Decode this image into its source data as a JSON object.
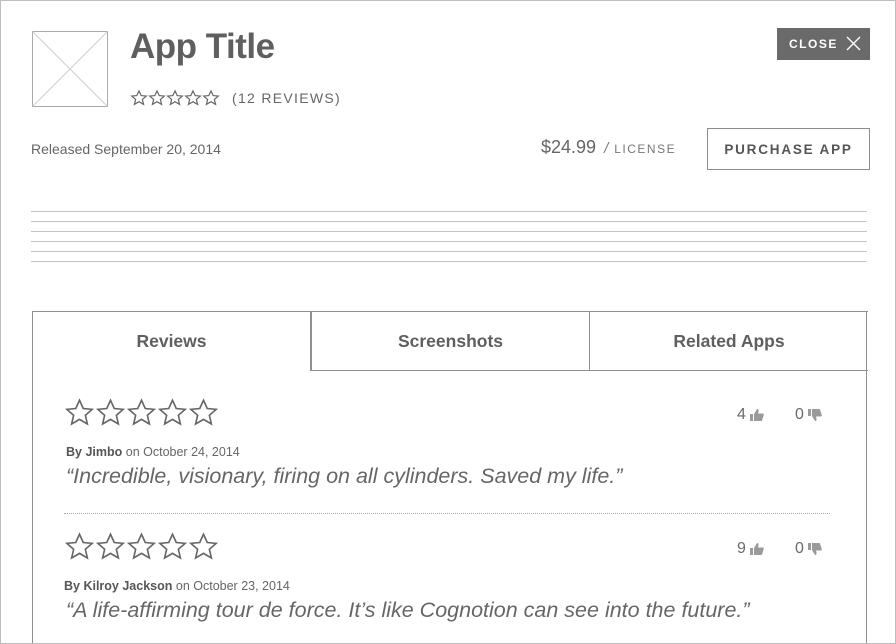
{
  "app": {
    "title": "App Title",
    "reviews_count": "(12 REVIEWS)",
    "released": "Released September 20, 2014",
    "price": "$24.99",
    "price_separator": "/",
    "price_unit": "LICENSE",
    "rating_stars": 0
  },
  "actions": {
    "close_label": "CLOSE",
    "purchase_label": "PURCHASE APP"
  },
  "tabs": [
    {
      "label": "Reviews",
      "active": true
    },
    {
      "label": "Screenshots",
      "active": false
    },
    {
      "label": "Related Apps",
      "active": false
    }
  ],
  "reviews": [
    {
      "author": "By Jimbo",
      "date": "on October 24, 2014",
      "quote": "“Incredible, visionary, firing on all cylinders. Saved my life.”",
      "stars": 0,
      "upvotes": "4",
      "downvotes": "0"
    },
    {
      "author": "By Kilroy Jackson",
      "date": "on October 23, 2014",
      "quote": "“A life-affirming tour de force. It’s like Cognotion can see into the future.”",
      "stars": 0,
      "upvotes": "9",
      "downvotes": "0"
    }
  ],
  "icons": {
    "close": "close-icon",
    "thumb_up": "thumbs-up-icon",
    "thumb_down": "thumbs-down-icon",
    "star": "star-outline-icon",
    "placeholder": "image-placeholder-icon"
  },
  "colors": {
    "close_button_bg": "#6a6a6a",
    "text": "#5f5f5f",
    "border": "#8f8f8f"
  }
}
